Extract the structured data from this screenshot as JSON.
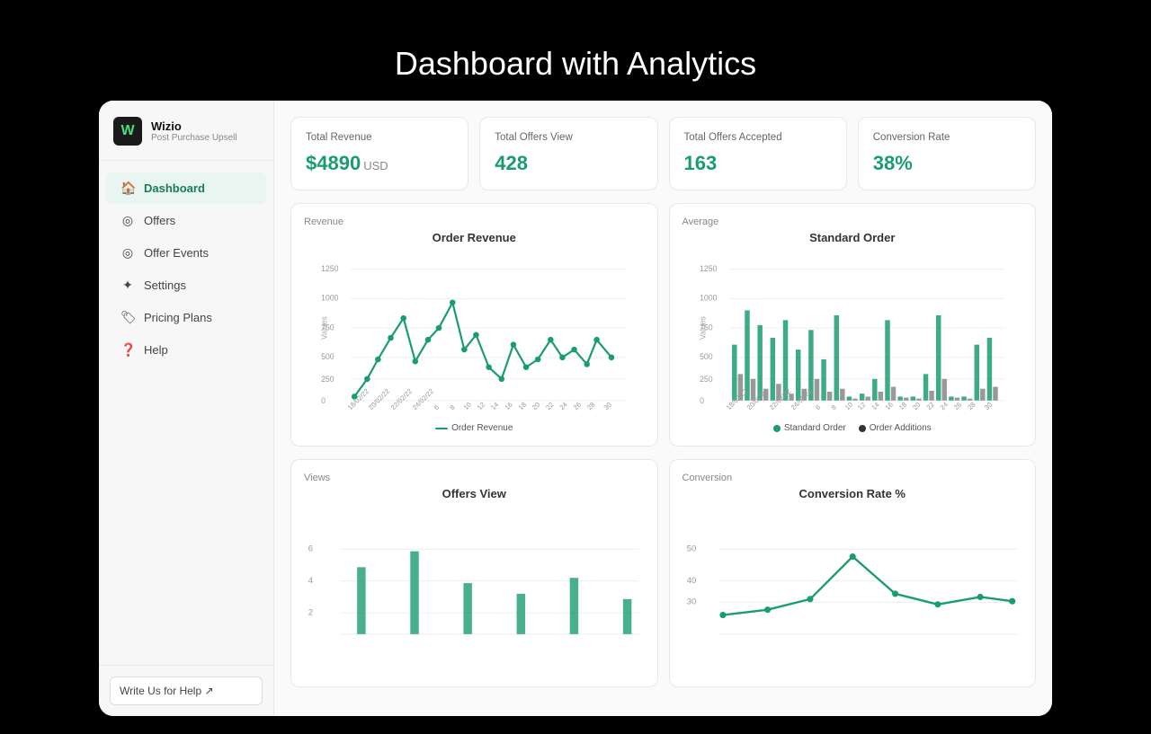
{
  "page": {
    "title": "Dashboard with Analytics"
  },
  "app": {
    "logo_letter": "W",
    "brand_name": "Wizio",
    "brand_sub": "Post Purchase Upsell"
  },
  "sidebar": {
    "items": [
      {
        "id": "dashboard",
        "label": "Dashboard",
        "icon": "🏠",
        "active": true
      },
      {
        "id": "offers",
        "label": "Offers",
        "icon": "⚙️",
        "active": false
      },
      {
        "id": "offer-events",
        "label": "Offer Events",
        "icon": "🔄",
        "active": false
      },
      {
        "id": "settings",
        "label": "Settings",
        "icon": "⚙️",
        "active": false
      },
      {
        "id": "pricing-plans",
        "label": "Pricing Plans",
        "icon": "🏷️",
        "active": false
      },
      {
        "id": "help",
        "label": "Help",
        "icon": "❓",
        "active": false
      }
    ],
    "footer_btn": "Write Us for Help ↗"
  },
  "stats": [
    {
      "label": "Total Revenue",
      "value": "$4890",
      "suffix": "USD",
      "color": "#1a9c72"
    },
    {
      "label": "Total Offers View",
      "value": "428",
      "suffix": "",
      "color": "#1a9c72"
    },
    {
      "label": "Total Offers Accepted",
      "value": "163",
      "suffix": "",
      "color": "#1a9c72"
    },
    {
      "label": "Conversion Rate",
      "value": "38%",
      "suffix": "",
      "color": "#1a9c72"
    }
  ],
  "charts": {
    "revenue": {
      "section": "Revenue",
      "title": "Order Revenue",
      "legend": [
        {
          "type": "line",
          "color": "#1a9c72",
          "label": "Order Revenue"
        }
      ]
    },
    "average": {
      "section": "Average",
      "title": "Standard Order",
      "legend": [
        {
          "type": "dot",
          "color": "#1a9c72",
          "label": "Standard Order"
        },
        {
          "type": "dot",
          "color": "#333",
          "label": "Order Additions"
        }
      ]
    },
    "views": {
      "section": "Views",
      "title": "Offers View"
    },
    "conversion": {
      "section": "Conversion",
      "title": "Conversion Rate %"
    }
  }
}
